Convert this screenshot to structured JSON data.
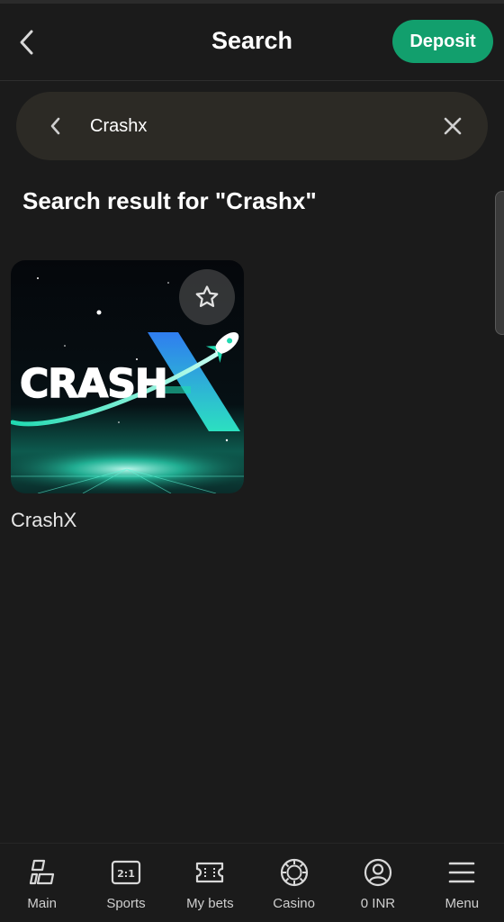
{
  "header": {
    "title": "Search",
    "deposit_label": "Deposit"
  },
  "search": {
    "value": "Crashx"
  },
  "results": {
    "heading": "Search result for \"Crashx\"",
    "games": [
      {
        "name": "CrashX",
        "thumb_text": "CRASH"
      }
    ]
  },
  "bottom_nav": [
    {
      "label": "Main",
      "icon": "main-icon"
    },
    {
      "label": "Sports",
      "icon": "sports-icon"
    },
    {
      "label": "My bets",
      "icon": "ticket-icon"
    },
    {
      "label": "Casino",
      "icon": "casino-chip-icon"
    },
    {
      "label": "0 INR",
      "icon": "account-icon"
    },
    {
      "label": "Menu",
      "icon": "hamburger-icon"
    }
  ],
  "colors": {
    "background": "#1b1b1b",
    "accent": "#129f6d",
    "search_bg": "#2c2a25",
    "game_glow": "#2ff0c8"
  }
}
